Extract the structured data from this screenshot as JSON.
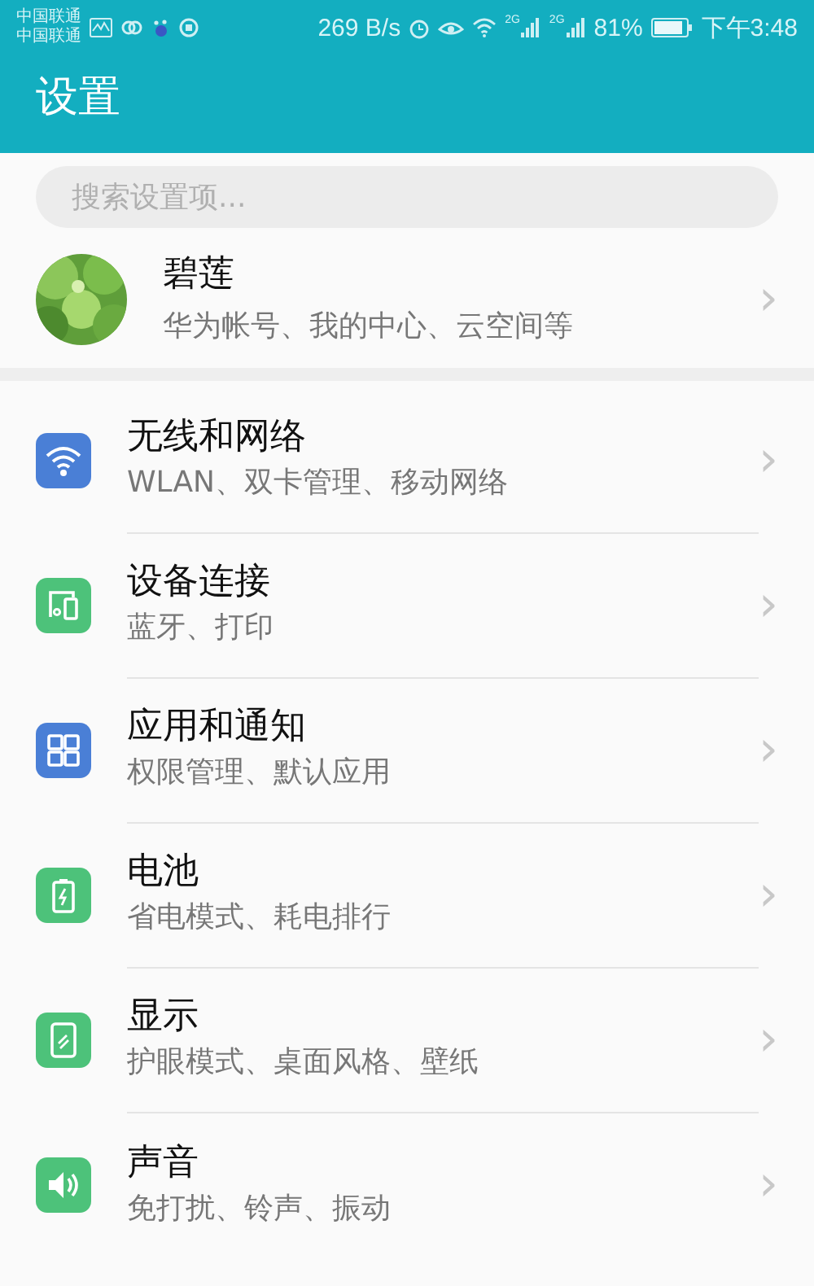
{
  "status_bar": {
    "carriers": [
      "中国联通",
      "中国联通"
    ],
    "speed": "269 B/s",
    "networks": [
      "2G",
      "2G"
    ],
    "battery": "81%",
    "time": "下午3:48"
  },
  "header": {
    "title": "设置"
  },
  "search": {
    "placeholder": "搜索设置项..."
  },
  "account": {
    "name": "碧莲",
    "subtitle": "华为帐号、我的中心、云空间等",
    "chevron": "›"
  },
  "items": [
    {
      "kind": "wifi",
      "color": "#4a7fd6",
      "title": "无线和网络",
      "subtitle": "WLAN、双卡管理、移动网络",
      "chevron": "›"
    },
    {
      "kind": "devices",
      "color": "#4dc27a",
      "title": "设备连接",
      "subtitle": "蓝牙、打印",
      "chevron": "›"
    },
    {
      "kind": "apps",
      "color": "#4a7fd6",
      "title": "应用和通知",
      "subtitle": "权限管理、默认应用",
      "chevron": "›"
    },
    {
      "kind": "battery",
      "color": "#4dc27a",
      "title": "电池",
      "subtitle": "省电模式、耗电排行",
      "chevron": "›"
    },
    {
      "kind": "display",
      "color": "#4dc27a",
      "title": "显示",
      "subtitle": "护眼模式、桌面风格、壁纸",
      "chevron": "›"
    },
    {
      "kind": "sound",
      "color": "#4dc27a",
      "title": "声音",
      "subtitle": "免打扰、铃声、振动",
      "chevron": "›"
    }
  ]
}
